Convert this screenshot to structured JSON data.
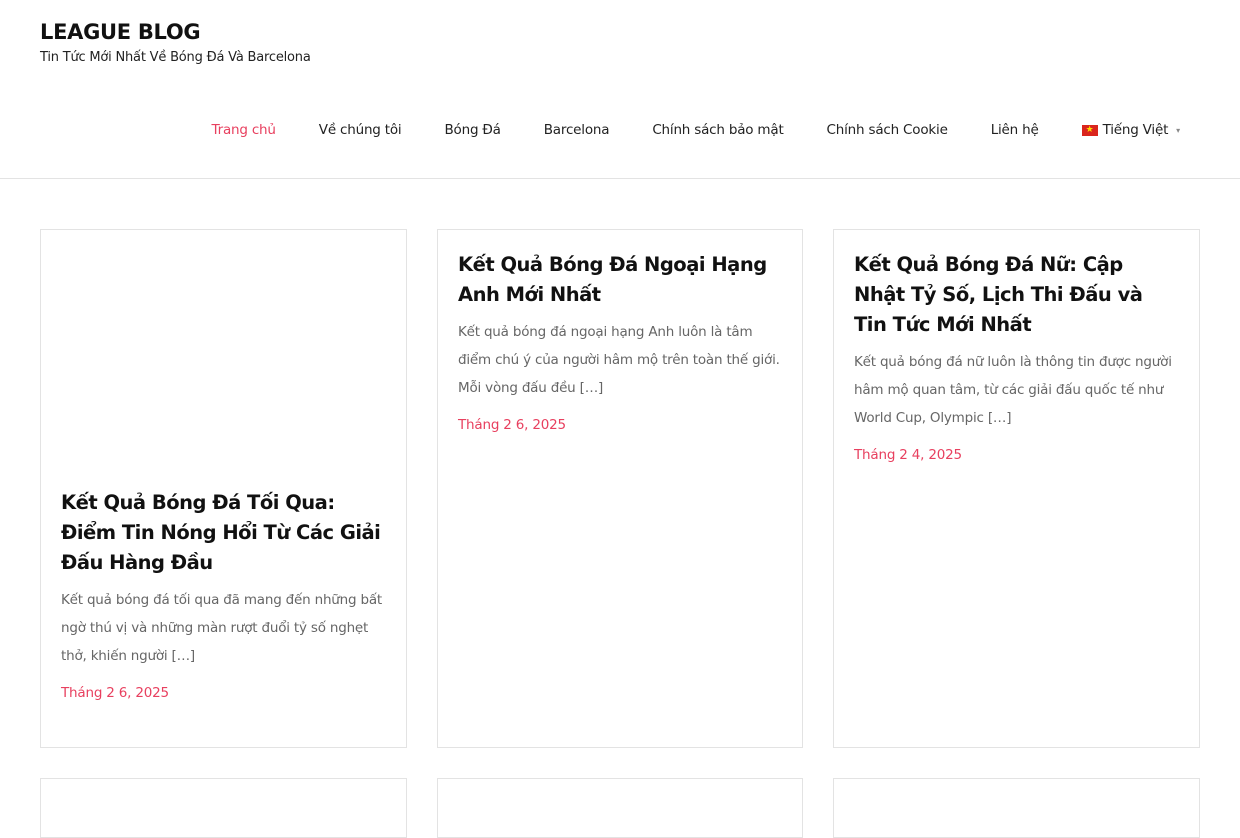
{
  "site": {
    "title": "LEAGUE BLOG",
    "tagline": "Tin Tức Mới Nhất Về Bóng Đá Và Barcelona"
  },
  "nav": {
    "items": [
      {
        "label": "Trang chủ",
        "active": true
      },
      {
        "label": "Về chúng tôi"
      },
      {
        "label": "Bóng Đá"
      },
      {
        "label": "Barcelona"
      },
      {
        "label": "Chính sách bảo mật"
      },
      {
        "label": "Chính sách Cookie"
      },
      {
        "label": "Liên hệ"
      }
    ],
    "language": {
      "label": "Tiếng Việt",
      "flag_icon": "vietnam-flag-icon",
      "caret_icon": "chevron-down-icon"
    }
  },
  "colors": {
    "accent": "#e8405f",
    "text": "#111111",
    "muted": "#666666",
    "border": "#e3e3e3"
  },
  "posts": [
    {
      "title": "Kết Quả Bóng Đá Tối Qua: Điểm Tin Nóng Hổi Từ Các Giải Đấu Hàng Đầu",
      "excerpt": "Kết quả bóng đá tối qua đã mang đến những bất ngờ thú vị và những màn rượt đuổi tỷ số nghẹt thở, khiến người […]",
      "date": "Tháng 2 6, 2025"
    },
    {
      "title": "Kết Quả Bóng Đá Ngoại Hạng Anh Mới Nhất",
      "excerpt": "Kết quả bóng đá ngoại hạng Anh luôn là tâm điểm chú ý của người hâm mộ trên toàn thế giới. Mỗi vòng đấu đều […]",
      "date": "Tháng 2 6, 2025"
    },
    {
      "title": "Kết Quả Bóng Đá Nữ: Cập Nhật Tỷ Số, Lịch Thi Đấu và Tin Tức Mới Nhất",
      "excerpt": "Kết quả bóng đá nữ luôn là thông tin được người hâm mộ quan tâm, từ các giải đấu quốc tế như World Cup, Olympic […]",
      "date": "Tháng 2 4, 2025"
    }
  ]
}
